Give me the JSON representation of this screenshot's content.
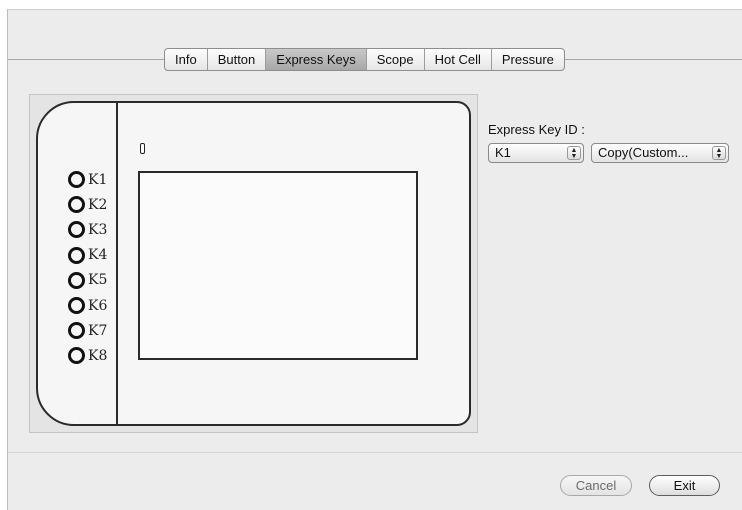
{
  "tabs": [
    {
      "label": "Info",
      "selected": false
    },
    {
      "label": "Button",
      "selected": false
    },
    {
      "label": "Express Keys",
      "selected": true
    },
    {
      "label": "Scope",
      "selected": false
    },
    {
      "label": "Hot Cell",
      "selected": false
    },
    {
      "label": "Pressure",
      "selected": false
    }
  ],
  "tablet": {
    "keys": [
      "K1",
      "K2",
      "K3",
      "K4",
      "K5",
      "K6",
      "K7",
      "K8"
    ]
  },
  "express_key": {
    "label": "Express Key ID :",
    "selected_key": "K1",
    "selected_action": "Copy(Custom..."
  },
  "icons": {
    "popup_arrows": "up-down-arrows-icon"
  },
  "buttons": {
    "cancel": "Cancel",
    "exit": "Exit"
  }
}
